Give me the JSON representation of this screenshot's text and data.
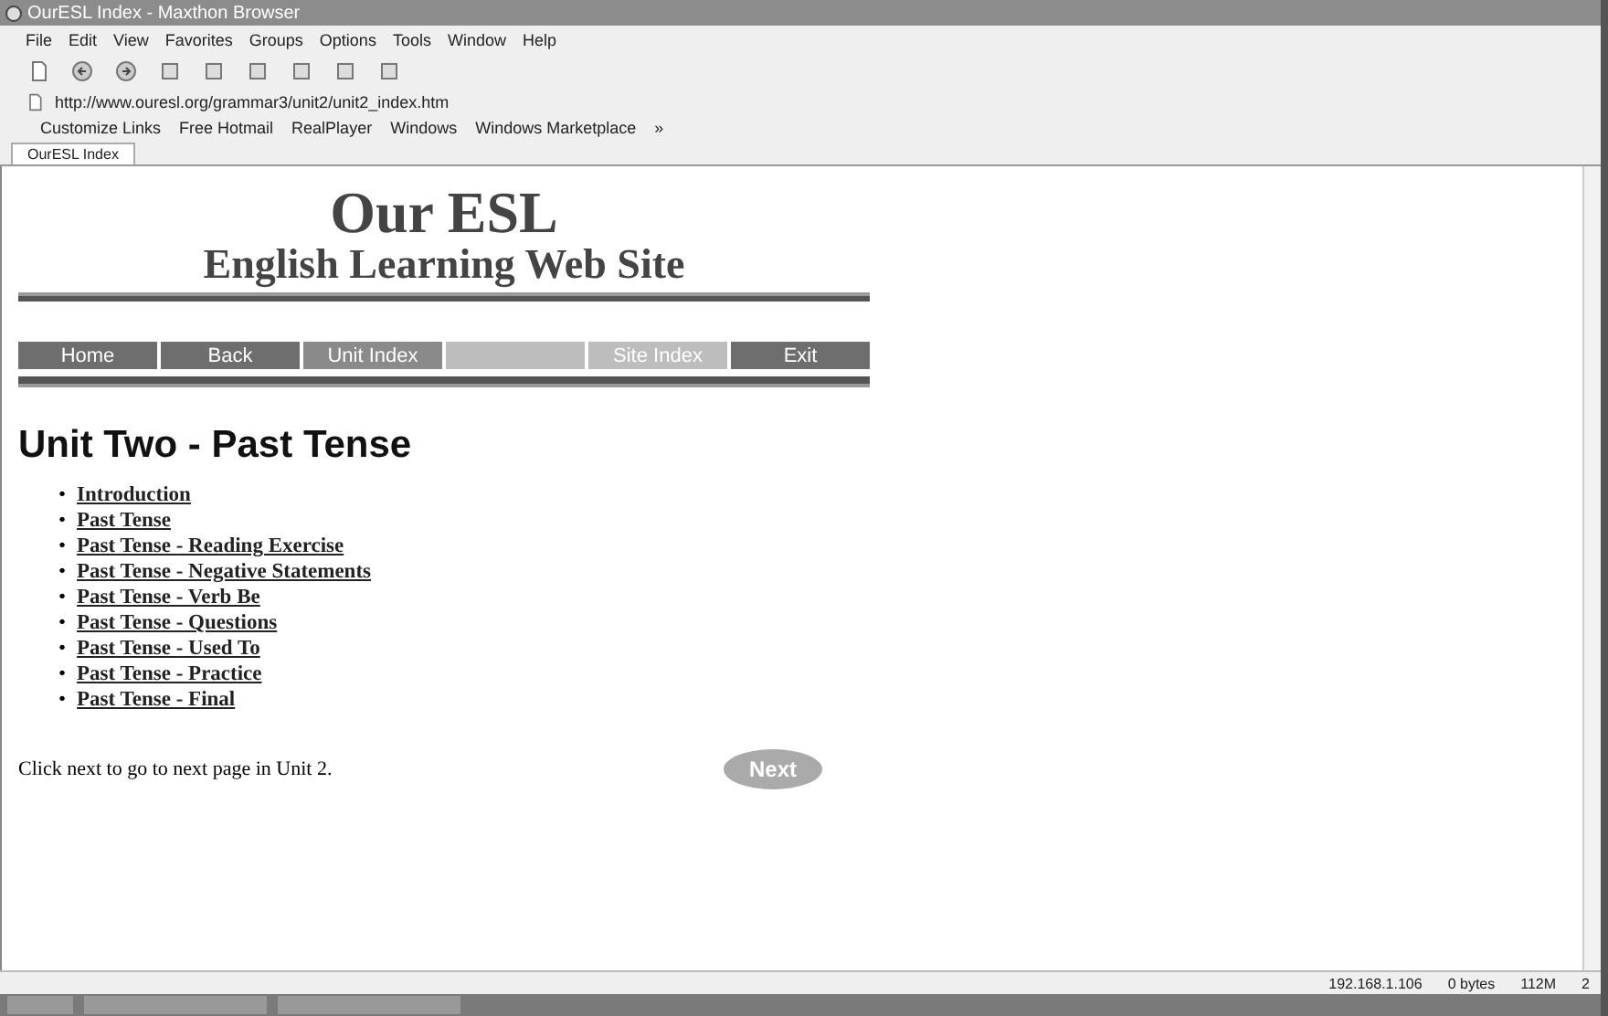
{
  "window": {
    "title": "OurESL Index - Maxthon Browser"
  },
  "menu": [
    "File",
    "Edit",
    "View",
    "Favorites",
    "Groups",
    "Options",
    "Tools",
    "Window",
    "Help"
  ],
  "address": {
    "value": "http://www.ouresl.org/grammar3/unit2/unit2_index.htm"
  },
  "links": [
    "Customize Links",
    "Free Hotmail",
    "RealPlayer",
    "Windows",
    "Windows Marketplace",
    "»"
  ],
  "tabs": [
    {
      "label": "OurESL Index",
      "selected": true
    }
  ],
  "page": {
    "title": "Our ESL",
    "subtitle": "English Learning Web Site",
    "nav": [
      {
        "label": "Home",
        "color": "#6e6e6e"
      },
      {
        "label": "Back",
        "color": "#6e6e6e"
      },
      {
        "label": "Unit Index",
        "color": "#8a8a8a"
      },
      {
        "color": "#bdbdbd"
      },
      {
        "label": "Site Index",
        "color": "#bdbdbd"
      },
      {
        "label": "Exit",
        "color": "#6e6e6e"
      }
    ],
    "heading": "Unit Two - Past Tense",
    "lessons": [
      {
        "bullet": "•",
        "label": "Introduction"
      },
      {
        "bullet": "•",
        "label": "Past Tense"
      },
      {
        "bullet": "•",
        "label": "Past Tense - Reading Exercise"
      },
      {
        "bullet": "•",
        "label": "Past Tense - Negative Statements"
      },
      {
        "bullet": "•",
        "label": "Past Tense - Verb Be"
      },
      {
        "bullet": "•",
        "label": "Past Tense - Questions"
      },
      {
        "bullet": "•",
        "label": "Past Tense - Used To"
      },
      {
        "bullet": "•",
        "label": "Past Tense - Practice"
      },
      {
        "bullet": "•",
        "label": "Past Tense - Final"
      }
    ],
    "footer": "Click next to go to next page in Unit 2.",
    "next": "Next"
  },
  "status_bar": [
    "192.168.1.106",
    "0 bytes",
    "112M",
    "2"
  ]
}
